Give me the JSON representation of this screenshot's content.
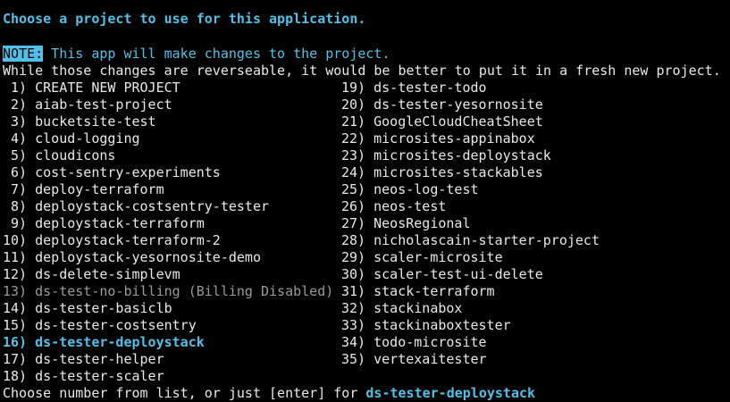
{
  "title": "Choose a project to use for this application.",
  "note": {
    "tag": "NOTE:",
    "text": " This app will make changes to the project."
  },
  "warning": "While those changes are reverseable, it would be better to put it in a fresh new project.",
  "projects": [
    {
      "num": " 1)",
      "name": "CREATE NEW PROJECT"
    },
    {
      "num": " 2)",
      "name": "aiab-test-project"
    },
    {
      "num": " 3)",
      "name": "bucketsite-test"
    },
    {
      "num": " 4)",
      "name": "cloud-logging"
    },
    {
      "num": " 5)",
      "name": "cloudicons"
    },
    {
      "num": " 6)",
      "name": "cost-sentry-experiments"
    },
    {
      "num": " 7)",
      "name": "deploy-terraform"
    },
    {
      "num": " 8)",
      "name": "deploystack-costsentry-tester"
    },
    {
      "num": " 9)",
      "name": "deploystack-terraform"
    },
    {
      "num": "10)",
      "name": "deploystack-terraform-2"
    },
    {
      "num": "11)",
      "name": "deploystack-yesornosite-demo"
    },
    {
      "num": "12)",
      "name": "ds-delete-simplevm"
    },
    {
      "num": "13)",
      "name": "ds-test-no-billing (Billing Disabled)",
      "state": "disabled"
    },
    {
      "num": "14)",
      "name": "ds-tester-basiclb"
    },
    {
      "num": "15)",
      "name": "ds-tester-costsentry"
    },
    {
      "num": "16)",
      "name": "ds-tester-deploystack",
      "state": "selected"
    },
    {
      "num": "17)",
      "name": "ds-tester-helper"
    },
    {
      "num": "18)",
      "name": "ds-tester-scaler"
    },
    {
      "num": "19)",
      "name": "ds-tester-todo"
    },
    {
      "num": "20)",
      "name": "ds-tester-yesornosite"
    },
    {
      "num": "21)",
      "name": "GoogleCloudCheatSheet"
    },
    {
      "num": "22)",
      "name": "microsites-appinabox"
    },
    {
      "num": "23)",
      "name": "microsites-deploystack"
    },
    {
      "num": "24)",
      "name": "microsites-stackables"
    },
    {
      "num": "25)",
      "name": "neos-log-test"
    },
    {
      "num": "26)",
      "name": "neos-test"
    },
    {
      "num": "27)",
      "name": "NeosRegional"
    },
    {
      "num": "28)",
      "name": "nicholascain-starter-project"
    },
    {
      "num": "29)",
      "name": "scaler-microsite"
    },
    {
      "num": "30)",
      "name": "scaler-test-ui-delete"
    },
    {
      "num": "31)",
      "name": "stack-terraform"
    },
    {
      "num": "32)",
      "name": "stackinabox"
    },
    {
      "num": "33)",
      "name": "stackinaboxtester"
    },
    {
      "num": "34)",
      "name": "todo-microsite"
    },
    {
      "num": "35)",
      "name": "vertexaitester"
    }
  ],
  "prompt": {
    "text": "Choose number from list, or just [enter] for ",
    "default": "ds-tester-deploystack"
  },
  "colors": {
    "accent": "#4fc1e9",
    "disabled": "#9a9a9a",
    "background": "#000000",
    "text": "#e8e8e8"
  }
}
